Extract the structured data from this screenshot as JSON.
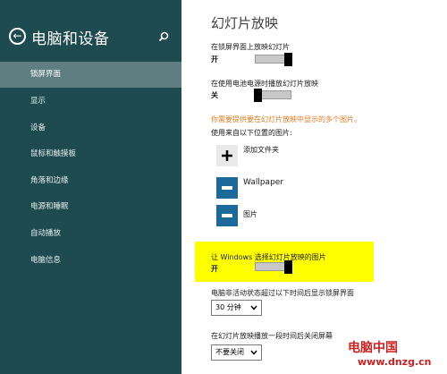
{
  "sidebar": {
    "title": "电脑和设备",
    "items": [
      {
        "label": "锁屏界面",
        "active": true
      },
      {
        "label": "显示"
      },
      {
        "label": "设备"
      },
      {
        "label": "鼠标和触摸板"
      },
      {
        "label": "角落和边缘"
      },
      {
        "label": "电源和睡眠"
      },
      {
        "label": "自动播放"
      },
      {
        "label": "电脑信息"
      }
    ]
  },
  "main": {
    "title": "幻灯片放映",
    "lockscreen_slideshow": {
      "label": "在锁屏界面上放映幻灯片",
      "state": "开"
    },
    "battery_slideshow": {
      "label": "在使用电池电源时播放幻灯片放映",
      "state": "关"
    },
    "warning": "你需要提供要在幻灯片放映中显示的多个图片。",
    "folders_label": "使用来自以下位置的图片:",
    "add_folder": "添加文件夹",
    "folders": [
      "Wallpaper",
      "图片"
    ],
    "windows_pick": {
      "label": "让 Windows 选择幻灯片放映的图片",
      "state": "开"
    },
    "inactive_label": "电脑非活动状态超过以下时间后显示锁屏界面",
    "inactive_value": "30 分钟",
    "screen_off_label": "在幻灯片放映播放一段时间后关闭屏幕",
    "screen_off_value": "不要关闭"
  },
  "watermark": {
    "logo": "电脑中国",
    "url": "www.dnzg.cn"
  },
  "colors": {
    "sidebar": "#1d4b50",
    "active_item": "#5f7e81",
    "warning": "#e07a1e",
    "highlight": "#ffff00",
    "tile": "#1c6a9a"
  }
}
